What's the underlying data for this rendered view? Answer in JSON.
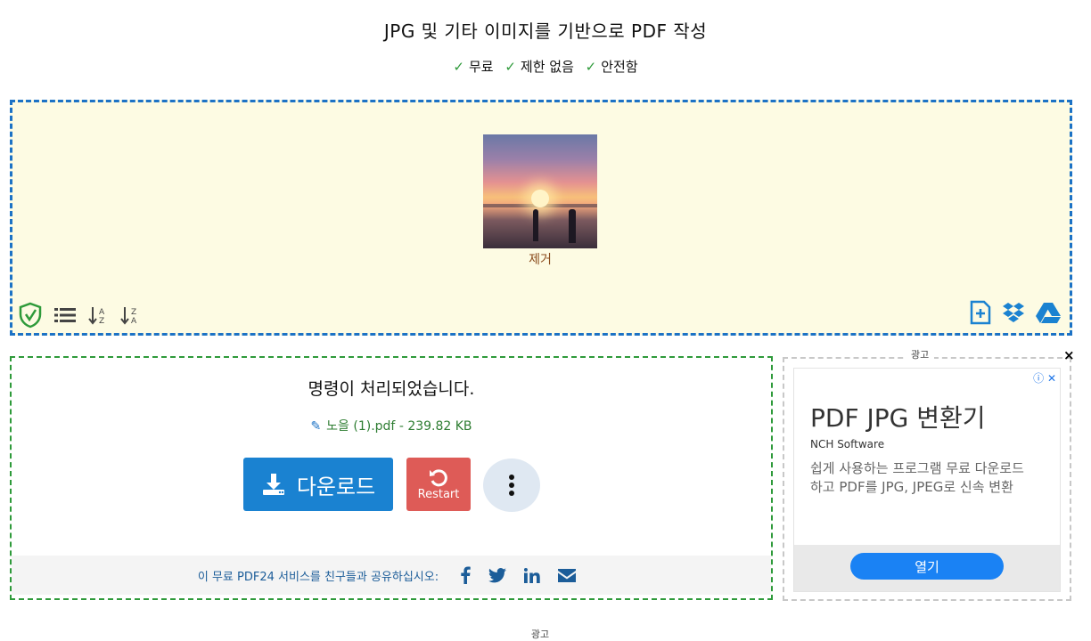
{
  "header": {
    "title": "",
    "subtitle": "JPG 및 기타 이미지를 기반으로 PDF 작성",
    "features": [
      "무료",
      "제한 없음",
      "안전함"
    ]
  },
  "dropzone": {
    "remove_label": "제거",
    "tools_left": [
      "shield-check-icon",
      "list-icon",
      "sort-az-icon",
      "sort-za-icon"
    ],
    "tools_right": [
      "add-file-icon",
      "dropbox-icon",
      "google-drive-icon"
    ]
  },
  "result": {
    "message": "명령이 처리되었습니다.",
    "file_label": "노을 (1).pdf - 239.82 KB",
    "download_label": "다운로드",
    "restart_label": "Restart",
    "share_text": "이 무료 PDF24 서비스를 친구들과 공유하십시오:",
    "share_icons": [
      "facebook-icon",
      "twitter-icon",
      "linkedin-icon",
      "email-icon"
    ]
  },
  "ad_side": {
    "label": "광고",
    "close": "×",
    "title": "PDF JPG 변환기",
    "brand": "NCH Software",
    "description": "쉽게 사용하는 프로그램 무료 다운로드하고 PDF를 JPG, JPEG로 신속 변환",
    "open_label": "열기"
  },
  "ad_bottom_label": "광고",
  "colors": {
    "accent": "#1a82d1",
    "restart": "#de5b57",
    "success": "#2e9a3a",
    "dropzone_bg": "#fdfbe3",
    "ad_button": "#1a82f4"
  }
}
